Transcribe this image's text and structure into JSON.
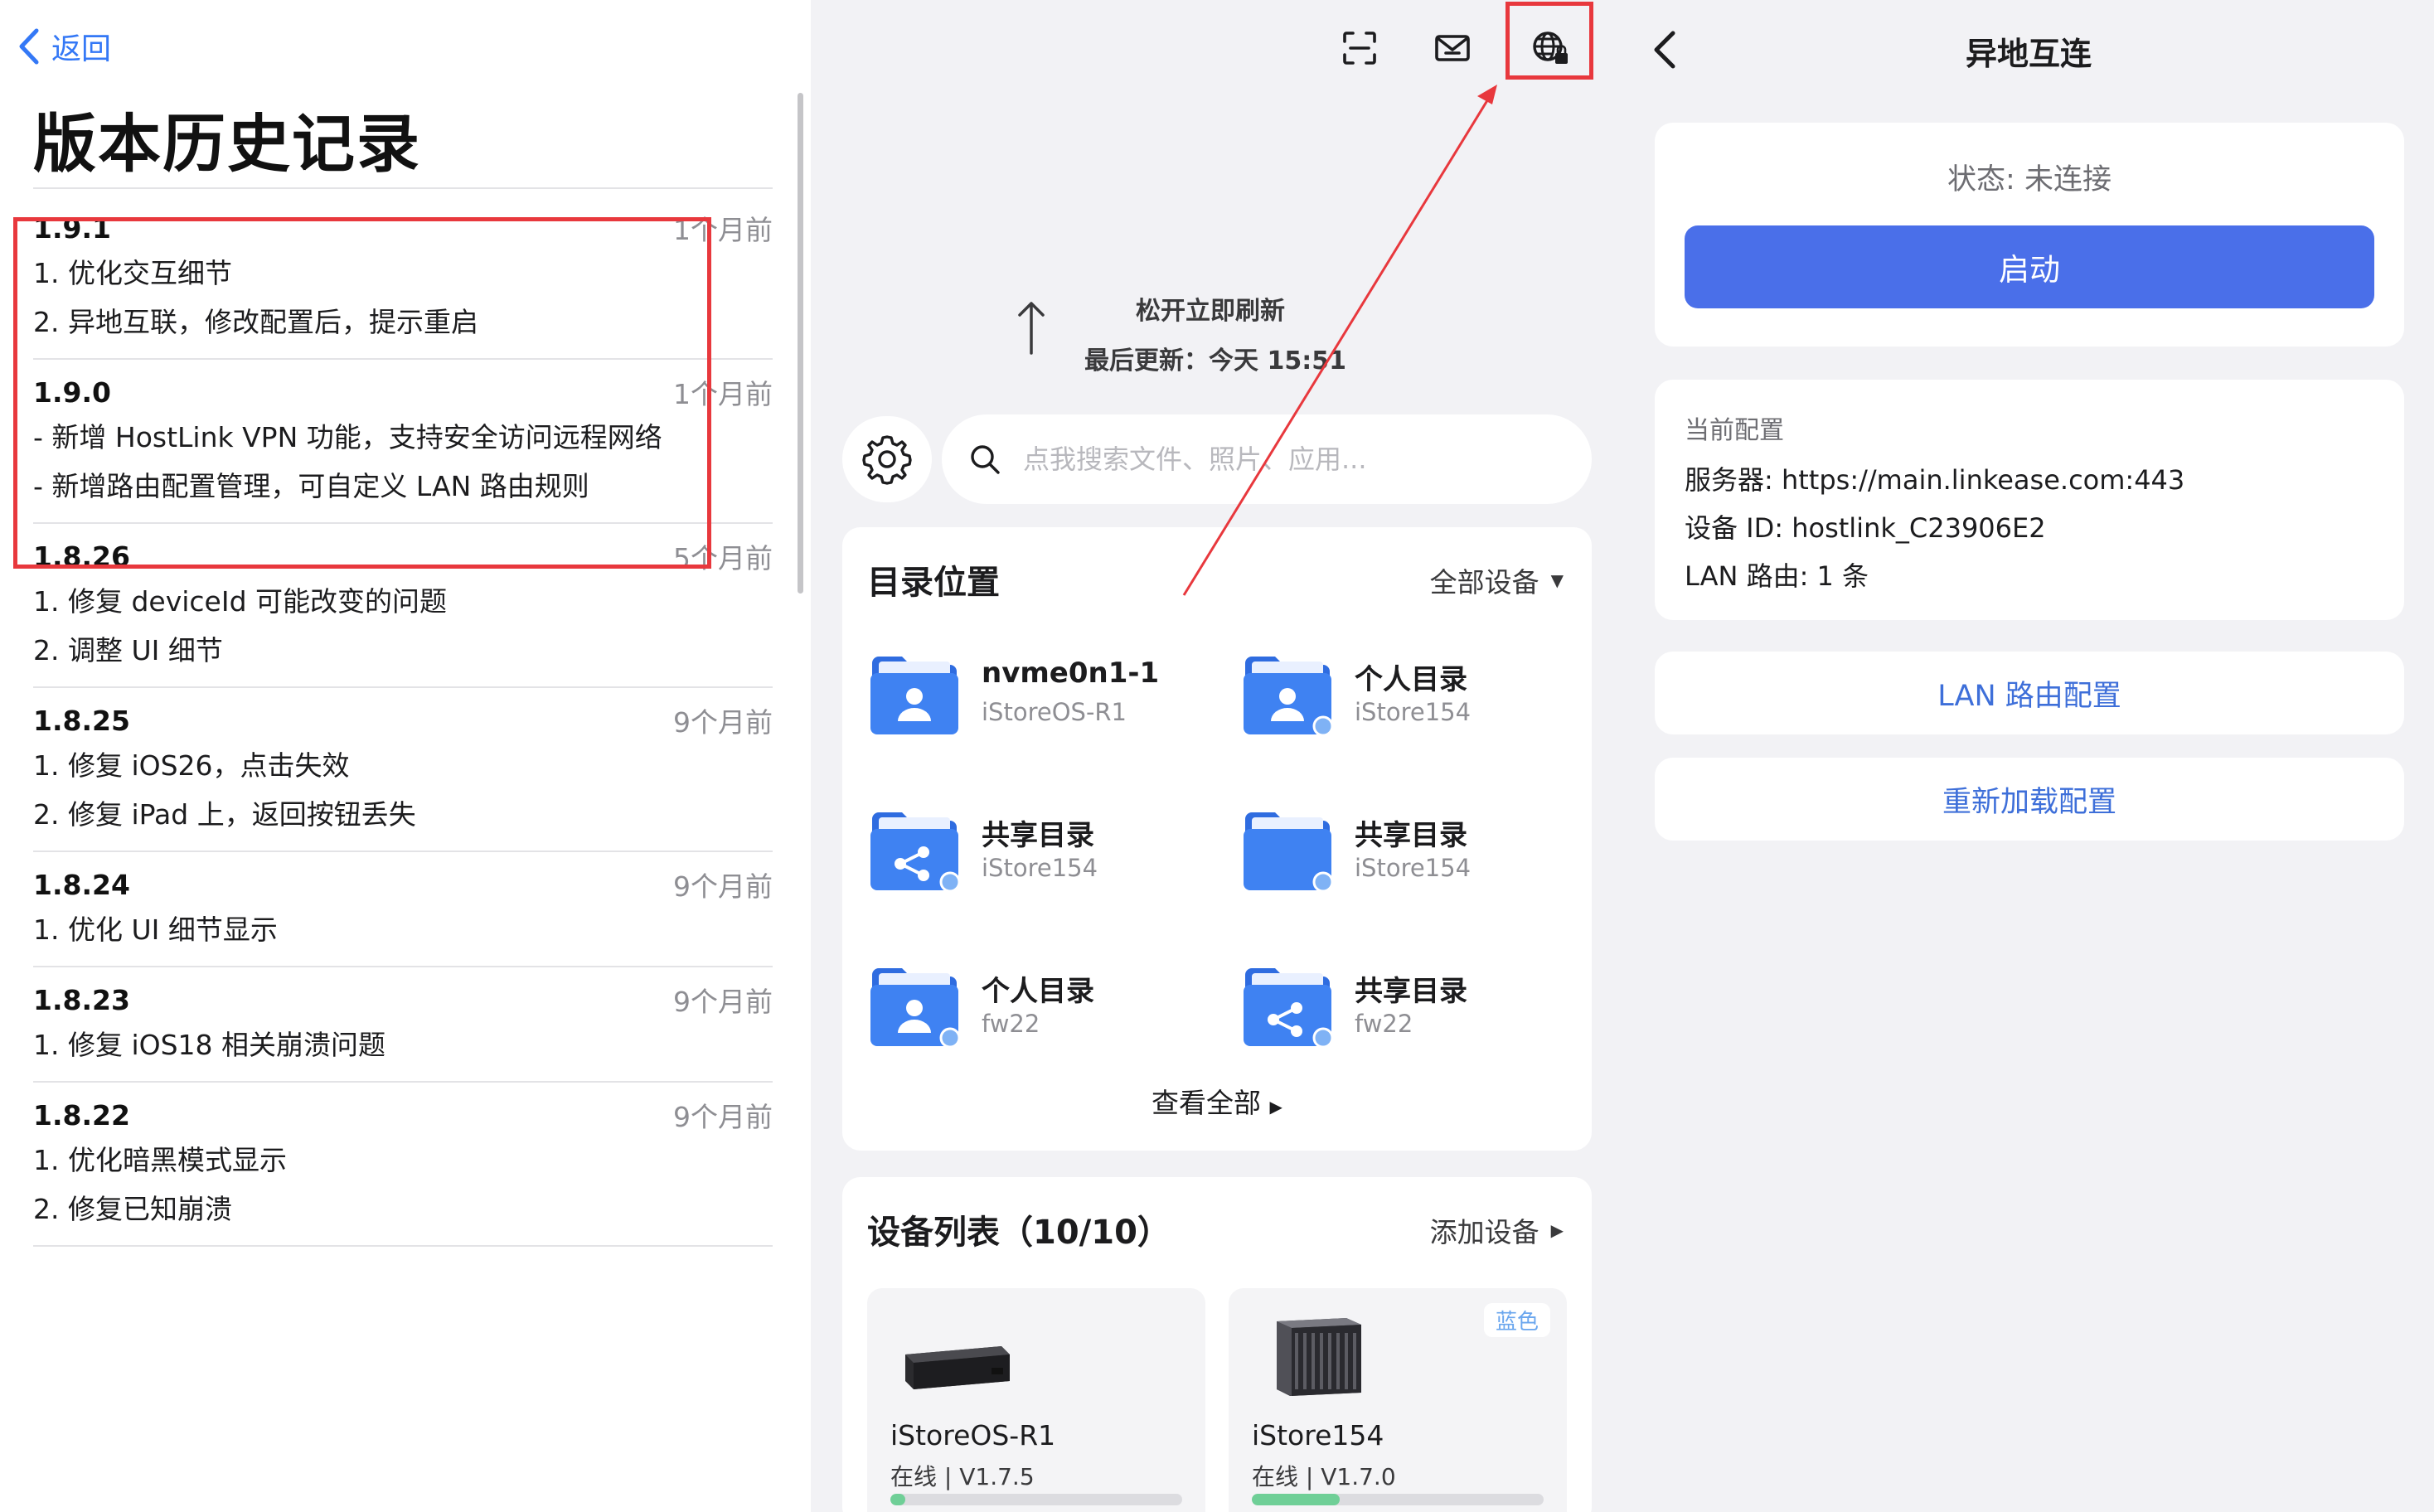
{
  "left": {
    "back_label": "返回",
    "title": "版本历史记录",
    "versions": [
      {
        "version": "1.9.1",
        "time": "1个月前",
        "lines": [
          "1. 优化交互细节",
          "2. 异地互联，修改配置后，提示重启"
        ]
      },
      {
        "version": "1.9.0",
        "time": "1个月前",
        "lines": [
          "- 新增 HostLink VPN 功能，支持安全访问远程网络",
          "- 新增路由配置管理，可自定义 LAN 路由规则"
        ]
      },
      {
        "version": "1.8.26",
        "time": "5个月前",
        "lines": [
          "1. 修复 deviceId 可能改变的问题",
          "2. 调整 UI 细节"
        ]
      },
      {
        "version": "1.8.25",
        "time": "9个月前",
        "lines": [
          "1. 修复 iOS26，点击失效",
          "2. 修复 iPad 上，返回按钮丢失"
        ]
      },
      {
        "version": "1.8.24",
        "time": "9个月前",
        "lines": [
          "1. 优化 UI 细节显示"
        ]
      },
      {
        "version": "1.8.23",
        "time": "9个月前",
        "lines": [
          "1. 修复 iOS18 相关崩溃问题"
        ]
      },
      {
        "version": "1.8.22",
        "time": "9个月前",
        "lines": [
          "1. 优化暗黑模式显示",
          "2. 修复已知崩溃"
        ]
      }
    ]
  },
  "middle": {
    "top_icons": [
      "scan-icon",
      "mail-icon",
      "globe-lock-icon"
    ],
    "pull_text": "松开立即刷新",
    "last_update": "最后更新：今天 15:51",
    "search_placeholder": "点我搜索文件、照片、应用...",
    "directory": {
      "title": "目录位置",
      "action": "全部设备",
      "view_all": "查看全部",
      "items": [
        {
          "name": "nvme0n1-1",
          "device": "iStoreOS-R1",
          "kind": "person",
          "dot": false
        },
        {
          "name": "个人目录",
          "device": "iStore154",
          "kind": "person",
          "dot": true
        },
        {
          "name": "共享目录",
          "device": "iStore154",
          "kind": "share",
          "dot": true
        },
        {
          "name": "共享目录",
          "device": "iStore154",
          "kind": "blank",
          "dot": true
        },
        {
          "name": "个人目录",
          "device": "fw22",
          "kind": "person",
          "dot": true
        },
        {
          "name": "共享目录",
          "device": "fw22",
          "kind": "share",
          "dot": true
        }
      ]
    },
    "devices": {
      "title": "设备列表（10/10）",
      "action": "添加设备",
      "items": [
        {
          "name": "iStoreOS-R1",
          "status": "在线 | V1.7.5",
          "usage": 0.05,
          "badge": ""
        },
        {
          "name": "iStore154",
          "status": "在线 | V1.7.0",
          "usage": 0.3,
          "badge": "蓝色"
        }
      ]
    }
  },
  "right": {
    "title": "异地互连",
    "status": "状态: 未连接",
    "start_label": "启动",
    "config_header": "当前配置",
    "config_rows": [
      "服务器: https://main.linkease.com:443",
      "设备 ID: hostlink_C23906E2",
      "LAN 路由: 1 条"
    ],
    "lan_route_label": "LAN 路由配置",
    "reload_label": "重新加载配置"
  },
  "colors": {
    "accent": "#4a6fe9",
    "link": "#3e6fd9",
    "annotation_red": "#e8383d",
    "folder_blue": "#3a7bf0",
    "online_green": "#6fcf97"
  }
}
